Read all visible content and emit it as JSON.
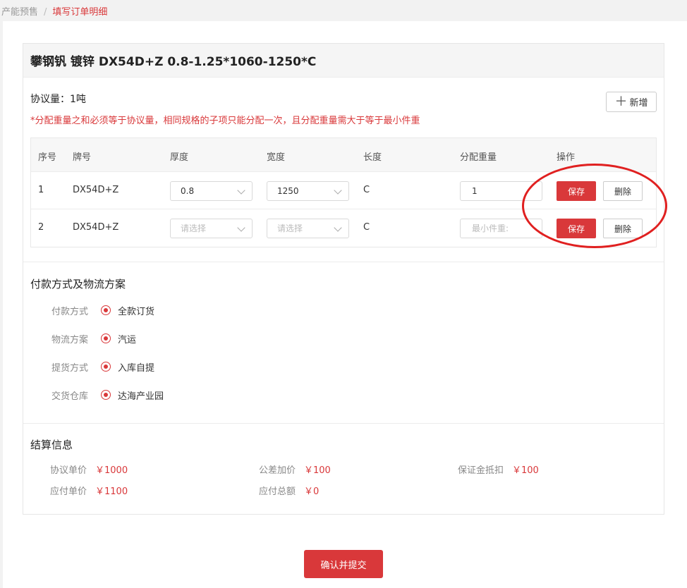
{
  "breadcrumb": {
    "parent": "产能预售",
    "separator": "/",
    "current": "填写订单明细"
  },
  "product": {
    "title": "攀钢钒 镀锌 DX54D+Z 0.8-1.25*1060-1250*C"
  },
  "agreement": {
    "label": "协议量：",
    "value": "1吨"
  },
  "notice": "*分配重量之和必须等于协议量，相同规格的子项只能分配一次，且分配重量需大于等于最小件重",
  "add_button": {
    "icon": "plus-icon",
    "label": "新增"
  },
  "table": {
    "headers": [
      "序号",
      "牌号",
      "厚度",
      "宽度",
      "长度",
      "分配重量",
      "操作"
    ],
    "rows": [
      {
        "index": "1",
        "grade": "DX54D+Z",
        "thickness": "0.8",
        "width": "1250",
        "length": "C",
        "weight": "1",
        "save": "保存",
        "delete": "删除"
      },
      {
        "index": "2",
        "grade": "DX54D+Z",
        "thickness_placeholder": "请选择",
        "width_placeholder": "请选择",
        "length": "C",
        "weight_placeholder": "最小件重:",
        "save": "保存",
        "delete": "删除"
      }
    ]
  },
  "payment": {
    "title": "付款方式及物流方案",
    "rows": [
      {
        "label": "付款方式",
        "value": "全款订货"
      },
      {
        "label": "物流方案",
        "value": "汽运"
      },
      {
        "label": "提货方式",
        "value": "入库自提"
      },
      {
        "label": "交货仓库",
        "value": "达海产业园"
      }
    ]
  },
  "settlement": {
    "title": "结算信息",
    "items": [
      {
        "label": "协议单价",
        "value": "￥1000"
      },
      {
        "label": "公差加价",
        "value": "￥100"
      },
      {
        "label": "保证金抵扣",
        "value": "￥100"
      },
      {
        "label": "应付单价",
        "value": "￥1100"
      },
      {
        "label": "应付总额",
        "value": "￥0"
      }
    ]
  },
  "submit_button": {
    "label": "确认并提交"
  },
  "colors": {
    "accent": "#d9383a",
    "annotation": "#e02020"
  }
}
